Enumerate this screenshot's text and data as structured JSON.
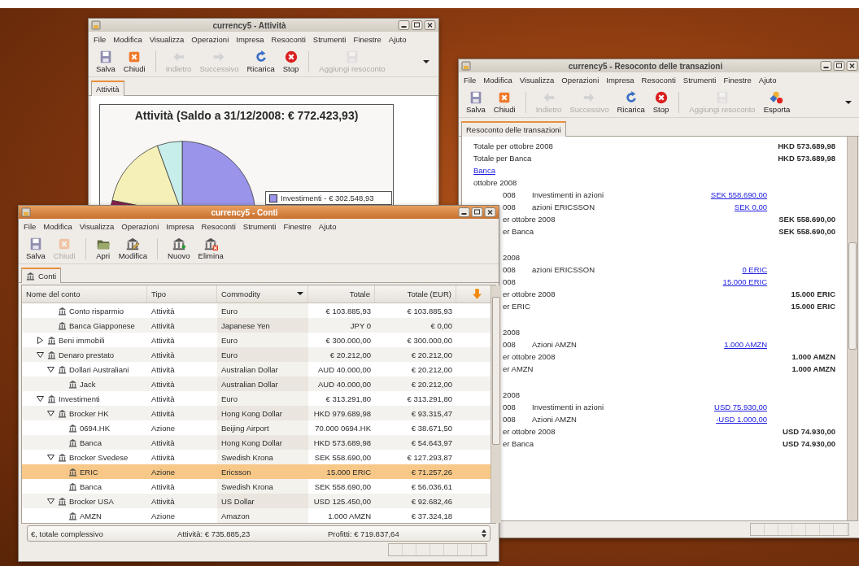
{
  "windows": [
    {
      "kind": "chart",
      "title": "currency5 - Attività",
      "active": false,
      "menu": [
        "File",
        "Modifica",
        "Visualizza",
        "Operazioni",
        "Impresa",
        "Resoconti",
        "Strumenti",
        "Finestre",
        "Ajuto"
      ],
      "toolbar": [
        {
          "kind": "save",
          "label": "Salva",
          "disabled": false
        },
        {
          "kind": "close",
          "label": "Chiudi",
          "disabled": false
        },
        {
          "kind": "separator"
        },
        {
          "kind": "back",
          "label": "Indietro",
          "disabled": true
        },
        {
          "kind": "forward",
          "label": "Successivo",
          "disabled": true
        },
        {
          "kind": "reload",
          "label": "Ricarica",
          "disabled": false
        },
        {
          "kind": "stop",
          "label": "Stop",
          "disabled": false
        },
        {
          "kind": "separator"
        },
        {
          "kind": "report",
          "label": "Aggiungi resoconto",
          "disabled": true
        },
        {
          "kind": "overflow"
        }
      ],
      "tab": {
        "label": "Attività",
        "selected": true
      },
      "chart": {
        "title": "Attività (Saldo a 31/12/2008: € 772.423,93)",
        "legend": [
          {
            "label": "Investimenti - € 302.548,93",
            "color": "#9a94ea"
          }
        ]
      }
    },
    {
      "kind": "report",
      "title": "currency5 - Resoconto delle transazioni",
      "active": false,
      "menu": [
        "File",
        "Modifica",
        "Visualizza",
        "Operazioni",
        "Impresa",
        "Resoconti",
        "Strumenti",
        "Finestre",
        "Ajuto"
      ],
      "toolbar": [
        {
          "kind": "save",
          "label": "Salva",
          "disabled": false
        },
        {
          "kind": "close",
          "label": "Chiudi",
          "disabled": false
        },
        {
          "kind": "separator"
        },
        {
          "kind": "back",
          "label": "Indietro",
          "disabled": true
        },
        {
          "kind": "forward",
          "label": "Successivo",
          "disabled": true
        },
        {
          "kind": "reload",
          "label": "Ricarica",
          "disabled": false
        },
        {
          "kind": "stop",
          "label": "Stop",
          "disabled": false
        },
        {
          "kind": "separator"
        },
        {
          "kind": "report",
          "label": "Aggiungi resoconto",
          "disabled": true
        },
        {
          "kind": "export",
          "label": "Esporta",
          "disabled": false
        },
        {
          "kind": "overflow"
        }
      ],
      "tab": {
        "label": "Resoconto delle transazioni",
        "selected": true
      },
      "blocks": [
        {
          "rows": [
            {
              "kind": "total",
              "cut": false,
              "label": "Totale per ottobre 2008",
              "value": "HKD 573.689,98"
            },
            {
              "kind": "total",
              "cut": false,
              "label": "Totale per Banca",
              "value": "HKD 573.689,98"
            },
            {
              "kind": "link",
              "cut": false,
              "label": "Banca"
            },
            {
              "kind": "heading",
              "cut": false,
              "label": "ottobre 2008"
            },
            {
              "kind": "txn",
              "cut": true,
              "date": "008",
              "description": "Investimenti in azioni",
              "amount": "SEK 558.690,00"
            },
            {
              "kind": "txn",
              "cut": true,
              "date": "008",
              "description": "azioni ERICSSON",
              "amount": "SEK 0,00"
            },
            {
              "kind": "total",
              "cut": true,
              "label": "er ottobre 2008",
              "value": "SEK 558.690,00"
            },
            {
              "kind": "total",
              "cut": true,
              "label": "er Banca",
              "value": "SEK 558.690,00"
            }
          ]
        },
        {
          "rows": [
            {
              "kind": "heading",
              "cut": true,
              "label": "2008"
            },
            {
              "kind": "txn",
              "cut": true,
              "date": "008",
              "description": "azioni ERICSSON",
              "amount": "0 ERIC"
            },
            {
              "kind": "txn",
              "cut": true,
              "date": "008",
              "amount": "15.000 ERIC"
            },
            {
              "kind": "total",
              "cut": true,
              "label": "er ottobre 2008",
              "value": "15.000 ERIC"
            },
            {
              "kind": "total",
              "cut": true,
              "label": "er ERIC",
              "value": "15.000 ERIC"
            }
          ]
        },
        {
          "rows": [
            {
              "kind": "heading",
              "cut": true,
              "label": "2008"
            },
            {
              "kind": "txn",
              "cut": true,
              "date": "008",
              "description": "Azioni AMZN",
              "amount": "1.000 AMZN"
            },
            {
              "kind": "total",
              "cut": true,
              "label": "er ottobre 2008",
              "value": "1.000 AMZN"
            },
            {
              "kind": "total",
              "cut": true,
              "label": "er AMZN",
              "value": "1.000 AMZN"
            }
          ]
        },
        {
          "rows": [
            {
              "kind": "heading",
              "cut": true,
              "label": "2008"
            },
            {
              "kind": "txn",
              "cut": true,
              "date": "008",
              "description": "Investimenti in azioni",
              "amount": "USD 75.930,00"
            },
            {
              "kind": "txn",
              "cut": true,
              "date": "008",
              "description": "Azioni AMZN",
              "amount": "-USD 1.000,00"
            },
            {
              "kind": "total",
              "cut": true,
              "label": "er ottobre 2008",
              "value": "USD 74.930,00"
            },
            {
              "kind": "total",
              "cut": true,
              "label": "er Banca",
              "value": "USD 74.930,00"
            }
          ]
        }
      ]
    },
    {
      "kind": "accounts",
      "title": "currency5 - Conti",
      "active": true,
      "menu": [
        "File",
        "Modifica",
        "Visualizza",
        "Operazioni",
        "Impresa",
        "Resoconti",
        "Strumenti",
        "Finestre",
        "Ajuto"
      ],
      "toolbar": [
        {
          "kind": "save",
          "label": "Salva",
          "disabled": false
        },
        {
          "kind": "close",
          "label": "Chiudi",
          "disabled": true
        },
        {
          "kind": "separator"
        },
        {
          "kind": "open",
          "label": "Apri",
          "disabled": false
        },
        {
          "kind": "edit",
          "label": "Modifica",
          "disabled": false
        },
        {
          "kind": "separator"
        },
        {
          "kind": "new",
          "label": "Nuovo",
          "disabled": false
        },
        {
          "kind": "delete",
          "label": "Elimina",
          "disabled": false
        }
      ],
      "tab": {
        "label": "Conti",
        "selected": true
      },
      "columns": [
        {
          "label": "Nome del conto",
          "sorted": false
        },
        {
          "label": "Tipo",
          "sorted": false
        },
        {
          "label": "Commodity",
          "sorted": true
        },
        {
          "label": "Totale",
          "sorted": false
        },
        {
          "label": "Totale (EUR)",
          "sorted": false
        }
      ],
      "continued_rows": [
        {
          "name": "Conto risparmio",
          "type": "Attività",
          "commodity": "Euro",
          "total": "€ 103.885,93",
          "total_eur": "€ 103.885,93",
          "selected": false
        },
        {
          "name": "Banca Giapponese",
          "type": "Attività",
          "commodity": "Japanese Yen",
          "total": "JPY 0",
          "total_eur": "€ 0,00",
          "selected": false
        }
      ],
      "tree": [
        {
          "name": "Beni immobili",
          "type": "Attività",
          "commodity": "Euro",
          "total": "€ 300.000,00",
          "total_eur": "€ 300.000,00",
          "selected": false,
          "expanded": false
        },
        {
          "name": "Denaro prestato",
          "type": "Attività",
          "commodity": "Euro",
          "total": "€ 20.212,00",
          "total_eur": "€ 20.212,00",
          "selected": false,
          "expanded": true,
          "children": [
            {
              "name": "Dollari Australiani",
              "type": "Attività",
              "commodity": "Australian Dollar",
              "total": "AUD 40.000,00",
              "total_eur": "€ 20.212,00",
              "selected": false,
              "expanded": true,
              "children": [
                {
                  "name": "Jack",
                  "type": "Attività",
                  "commodity": "Australian Dollar",
                  "total": "AUD 40.000,00",
                  "total_eur": "€ 20.212,00",
                  "selected": false
                }
              ]
            }
          ]
        },
        {
          "name": "Investimenti",
          "type": "Attività",
          "commodity": "Euro",
          "total": "€ 313.291,80",
          "total_eur": "€ 313.291,80",
          "selected": false,
          "expanded": true,
          "children": [
            {
              "name": "Brocker HK",
              "type": "Attività",
              "commodity": "Hong Kong Dollar",
              "total": "HKD 979.689,98",
              "total_eur": "€ 93.315,47",
              "selected": false,
              "expanded": true,
              "children": [
                {
                  "name": "0694.HK",
                  "type": "Azione",
                  "commodity": "Beijing Airport",
                  "total": "70.000 0694.HK",
                  "total_eur": "€ 38.671,50",
                  "selected": false
                },
                {
                  "name": "Banca",
                  "type": "Attività",
                  "commodity": "Hong Kong Dollar",
                  "total": "HKD 573.689,98",
                  "total_eur": "€ 54.643,97",
                  "selected": false
                }
              ]
            },
            {
              "name": "Brocker Svedese",
              "type": "Attività",
              "commodity": "Swedish Krona",
              "total": "SEK 558.690,00",
              "total_eur": "€ 127.293,87",
              "selected": false,
              "expanded": true,
              "children": [
                {
                  "name": "ERIC",
                  "type": "Azione",
                  "commodity": "Ericsson",
                  "total": "15.000 ERIC",
                  "total_eur": "€ 71.257,26",
                  "selected": true
                },
                {
                  "name": "Banca",
                  "type": "Attività",
                  "commodity": "Swedish Krona",
                  "total": "SEK 558.690,00",
                  "total_eur": "€ 56.036,61",
                  "selected": false
                }
              ]
            },
            {
              "name": "Brocker USA",
              "type": "Attività",
              "commodity": "US Dollar",
              "total": "USD 125.450,00",
              "total_eur": "€ 92.682,46",
              "selected": false,
              "expanded": true,
              "children": [
                {
                  "name": "AMZN",
                  "type": "Azione",
                  "commodity": "Amazon",
                  "total": "1.000 AMZN",
                  "total_eur": "€ 37.324,18",
                  "selected": false
                }
              ]
            }
          ]
        }
      ],
      "summary": {
        "currency": "€, totale complessivo",
        "assets": "Attività: € 735.885,23",
        "profits": "Profitti: € 719.837,64"
      }
    }
  ]
}
